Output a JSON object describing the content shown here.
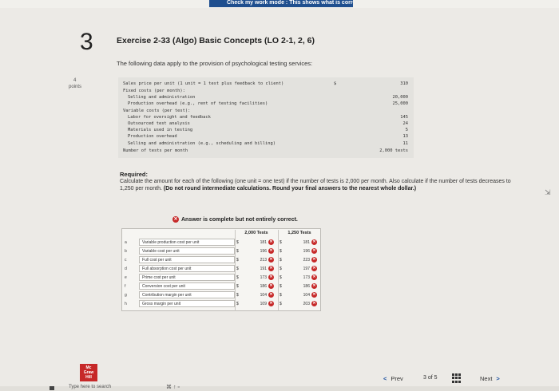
{
  "top_banner": "Check my work mode : This shows what is correct or incorrect",
  "question": {
    "number": "3",
    "points_value": "4",
    "points_label": "points",
    "title": "Exercise 2-33 (Algo) Basic Concepts (LO 2-1, 2, 6)",
    "intro": "The following data apply to the provision of psychological testing services:"
  },
  "data_lines": [
    {
      "label": "Sales price per unit (1 unit = 1 test plus feedback to client)",
      "value": "310",
      "dollar": "$"
    },
    {
      "label": "Fixed costs (per month):",
      "value": ""
    },
    {
      "label": "  Selling and administration",
      "value": "20,000"
    },
    {
      "label": "  Production overhead (e.g., rent of testing facilities)",
      "value": "25,000"
    },
    {
      "label": "Variable costs (per test):",
      "value": ""
    },
    {
      "label": "  Labor for oversight and feedback",
      "value": "145"
    },
    {
      "label": "  Outsourced test analysis",
      "value": "24"
    },
    {
      "label": "  Materials used in testing",
      "value": "5"
    },
    {
      "label": "  Production overhead",
      "value": "13"
    },
    {
      "label": "  Selling and administration (e.g., scheduling and billing)",
      "value": "11"
    },
    {
      "label": "Number of tests per month",
      "value": "2,000 tests"
    }
  ],
  "required": {
    "title": "Required:",
    "text": "Calculate the amount for each of the following (one unit = one test) if the number of tests is 2,000 per month. Also calculate if the number of tests decreases to 1,250 per month.",
    "bold_text": "(Do not round intermediate calculations. Round your final answers to the nearest whole dollar.)"
  },
  "answer": {
    "banner": "Answer is complete but not entirely correct.",
    "columns": [
      "2,000 Tests",
      "1,250 Tests"
    ],
    "rows": [
      {
        "letter": "a",
        "label": "Variable production cost per unit",
        "v1": "181",
        "v2": "181"
      },
      {
        "letter": "b",
        "label": "Variable cost per unit",
        "v1": "196",
        "v2": "196"
      },
      {
        "letter": "c",
        "label": "Full cost per unit",
        "v1": "213",
        "v2": "223"
      },
      {
        "letter": "d",
        "label": "Full absorption cost per unit",
        "v1": "191",
        "v2": "197"
      },
      {
        "letter": "e",
        "label": "Prime cost per unit",
        "v1": "173",
        "v2": "173"
      },
      {
        "letter": "f",
        "label": "Conversion cost per unit",
        "v1": "186",
        "v2": "186"
      },
      {
        "letter": "g",
        "label": "Contribution margin per unit",
        "v1": "104",
        "v2": "104"
      },
      {
        "letter": "h",
        "label": "Gross margin per unit",
        "v1": "109",
        "v2": "203"
      }
    ]
  },
  "navigation": {
    "prev_label": "Prev",
    "page_current": "3",
    "page_of": "of",
    "page_total": "5",
    "next_label": "Next"
  },
  "logo_text": [
    "Mc",
    "Graw",
    "Hill"
  ],
  "footer": {
    "fragment": "Type here to search",
    "sym": "⌘ ↑ ▫"
  },
  "colors": {
    "accent": "#1a4fa0",
    "incorrect": "#c62828"
  }
}
